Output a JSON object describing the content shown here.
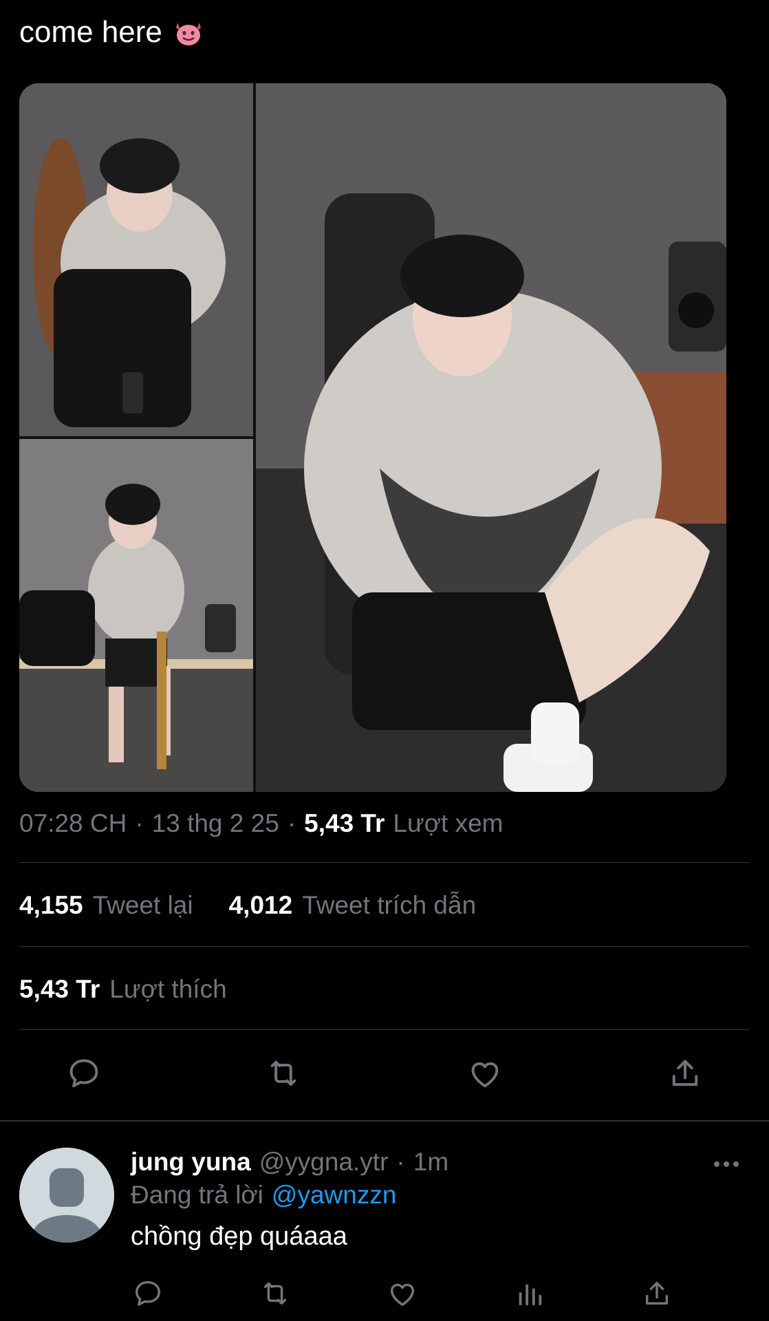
{
  "tweet": {
    "text": "come here",
    "emoji_icon": "smiling-devil-icon"
  },
  "media": {
    "count": 3,
    "layout": "left column two stacked photos, right large photo"
  },
  "meta": {
    "time": "07:28 CH",
    "sep1": "·",
    "date": "13 thg 2 25",
    "sep2": "·",
    "views_count": "5,43 Tr",
    "views_label": "Lượt xem"
  },
  "stats": {
    "retweets_count": "4,155",
    "retweets_label": "Tweet lại",
    "quotes_count": "4,012",
    "quotes_label": "Tweet trích dẫn",
    "likes_count": "5,43 Tr",
    "likes_label": "Lượt thích"
  },
  "actions": [
    "reply-icon",
    "retweet-icon",
    "like-icon",
    "share-icon"
  ],
  "reply": {
    "name": "jung yuna",
    "handle": "@yygna.ytr",
    "dot": "·",
    "time": "1m",
    "replying_label": "Đang trả lời",
    "replying_to": "@yawnzzn",
    "text": "chồng đẹp quáaaa",
    "actions": [
      "reply-icon",
      "retweet-icon",
      "like-icon",
      "views-icon",
      "share-icon"
    ]
  },
  "colors": {
    "background": "#000000",
    "text": "#e7e9ea",
    "muted": "#71767b",
    "link": "#1d9bf0",
    "divider": "#2f3336"
  }
}
